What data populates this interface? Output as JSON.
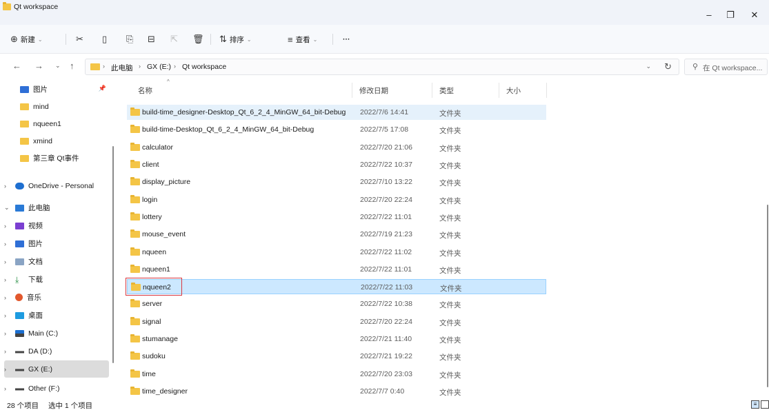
{
  "window": {
    "title": "Qt workspace",
    "minimize_glyph": "–",
    "maximize_glyph": "❐",
    "close_glyph": "✕"
  },
  "toolbar": {
    "new_label": "新建",
    "sort_label": "排序",
    "view_label": "查看",
    "more_label": "···",
    "icons": [
      "plus-circle-icon",
      "cut-icon",
      "copy-icon",
      "paste-icon",
      "rename-icon",
      "share-icon",
      "delete-icon",
      "sort-icon",
      "view-icon"
    ]
  },
  "address": {
    "crumbs": [
      "此电脑",
      "GX (E:)",
      "Qt workspace"
    ],
    "search_placeholder": "在 Qt workspace..."
  },
  "sidebar": {
    "items": [
      {
        "label": "图片",
        "icon": "pictures-icon",
        "pinned": true,
        "expandable": false
      },
      {
        "label": "mind",
        "icon": "folder-icon",
        "expandable": false
      },
      {
        "label": "nqueen1",
        "icon": "folder-icon",
        "expandable": false
      },
      {
        "label": "xmind",
        "icon": "folder-icon",
        "expandable": false
      },
      {
        "label": "第三章 Qt事件",
        "icon": "folder-icon",
        "expandable": false
      },
      {
        "label": "OneDrive - Personal",
        "icon": "cloud-icon",
        "expandable": true
      },
      {
        "label": "此电脑",
        "icon": "computer-icon",
        "expandable": true,
        "expanded": true
      },
      {
        "label": "视频",
        "icon": "videos-icon",
        "expandable": true
      },
      {
        "label": "图片",
        "icon": "pictures-icon",
        "expandable": true
      },
      {
        "label": "文档",
        "icon": "documents-icon",
        "expandable": true
      },
      {
        "label": "下载",
        "icon": "downloads-icon",
        "expandable": true
      },
      {
        "label": "音乐",
        "icon": "music-icon",
        "expandable": true
      },
      {
        "label": "桌面",
        "icon": "desktop-icon",
        "expandable": true
      },
      {
        "label": "Main (C:)",
        "icon": "windows-drive-icon",
        "expandable": true
      },
      {
        "label": "DA (D:)",
        "icon": "drive-icon",
        "expandable": true
      },
      {
        "label": "GX (E:)",
        "icon": "drive-icon",
        "expandable": true,
        "selected": true
      },
      {
        "label": "Other (F:)",
        "icon": "drive-icon",
        "expandable": true
      }
    ]
  },
  "columns": {
    "name": "名称",
    "date": "修改日期",
    "type": "类型",
    "size": "大小"
  },
  "files": [
    {
      "name": "build-time_designer-Desktop_Qt_6_2_4_MinGW_64_bit-Debug",
      "date": "2022/7/6 14:41",
      "type": "文件夹",
      "state": "hover"
    },
    {
      "name": "build-time-Desktop_Qt_6_2_4_MinGW_64_bit-Debug",
      "date": "2022/7/5 17:08",
      "type": "文件夹"
    },
    {
      "name": "calculator",
      "date": "2022/7/20 21:06",
      "type": "文件夹"
    },
    {
      "name": "client",
      "date": "2022/7/22 10:37",
      "type": "文件夹"
    },
    {
      "name": "display_picture",
      "date": "2022/7/10 13:22",
      "type": "文件夹"
    },
    {
      "name": "login",
      "date": "2022/7/20 22:24",
      "type": "文件夹"
    },
    {
      "name": "lottery",
      "date": "2022/7/22 11:01",
      "type": "文件夹"
    },
    {
      "name": "mouse_event",
      "date": "2022/7/19 21:23",
      "type": "文件夹"
    },
    {
      "name": "nqueen",
      "date": "2022/7/22 11:02",
      "type": "文件夹"
    },
    {
      "name": "nqueen1",
      "date": "2022/7/22 11:01",
      "type": "文件夹"
    },
    {
      "name": "nqueen2",
      "date": "2022/7/22 11:03",
      "type": "文件夹",
      "state": "selected"
    },
    {
      "name": "server",
      "date": "2022/7/22 10:38",
      "type": "文件夹"
    },
    {
      "name": "signal",
      "date": "2022/7/20 22:24",
      "type": "文件夹"
    },
    {
      "name": "stumanage",
      "date": "2022/7/21 11:40",
      "type": "文件夹"
    },
    {
      "name": "sudoku",
      "date": "2022/7/21 19:22",
      "type": "文件夹"
    },
    {
      "name": "time",
      "date": "2022/7/20 23:03",
      "type": "文件夹"
    },
    {
      "name": "time_designer",
      "date": "2022/7/7 0:40",
      "type": "文件夹"
    }
  ],
  "status": {
    "count": "28 个项目",
    "selection": "选中 1 个项目"
  },
  "colors": {
    "folder": "#f4c546",
    "selection": "#cce8ff",
    "highlight_box": "#d9363e"
  }
}
